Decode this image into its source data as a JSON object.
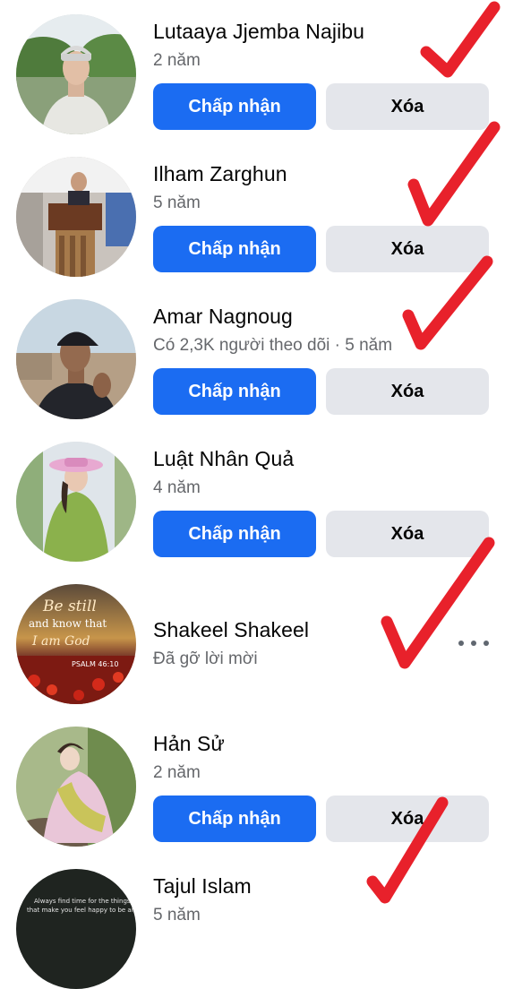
{
  "requests": [
    {
      "name": "Lutaaya Jjemba Najibu",
      "subtitle": "2 năm",
      "accept_label": "Chấp nhận",
      "delete_label": "Xóa"
    },
    {
      "name": "Ilham Zarghun",
      "subtitle": "5 năm",
      "accept_label": "Chấp nhận",
      "delete_label": "Xóa"
    },
    {
      "name": "Amar Nagnoug",
      "subtitle": "Có 2,3K người theo dõi · 5 năm",
      "accept_label": "Chấp nhận",
      "delete_label": "Xóa"
    },
    {
      "name": "Luật Nhân Quả",
      "subtitle": "4 năm",
      "accept_label": "Chấp nhận",
      "delete_label": "Xóa"
    },
    {
      "name": "Shakeel Shakeel",
      "subtitle": "Đã gỡ lời mời",
      "avatar_text": [
        "Be still",
        "and know that",
        "I am God",
        "PSALM 46:10"
      ]
    },
    {
      "name": "Hản Sử",
      "subtitle": "2 năm",
      "accept_label": "Chấp nhận",
      "delete_label": "Xóa"
    },
    {
      "name": "Tajul Islam",
      "subtitle": "5 năm",
      "avatar_text": [
        "Always find time for the things",
        "that make you feel happy to be alive."
      ]
    }
  ],
  "colors": {
    "accept_button": "#1b6cf2",
    "delete_button": "#e4e6eb",
    "subtitle_text": "#65676b",
    "checkmark": "#e8212b"
  },
  "icons": [
    "more-options-icon",
    "checkmark-icon"
  ]
}
